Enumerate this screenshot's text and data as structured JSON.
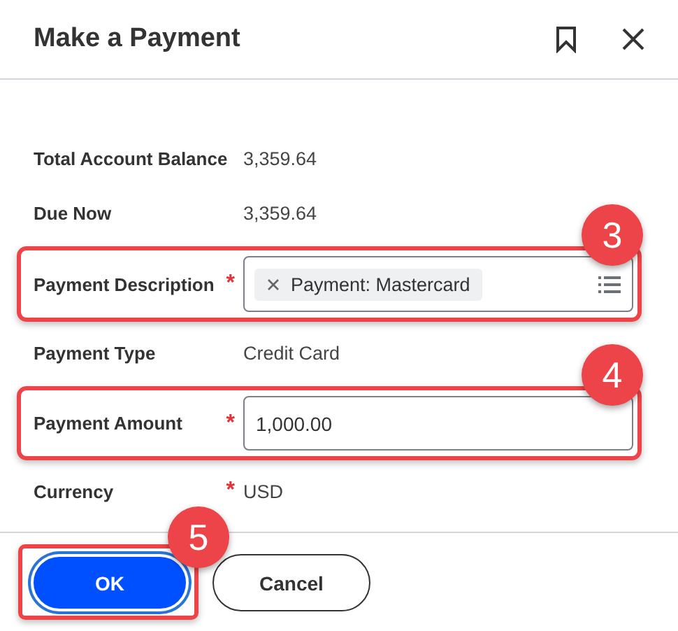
{
  "dialog": {
    "title": "Make a Payment"
  },
  "fields": [
    {
      "kind": "static",
      "label": "Total Account Balance",
      "value": "3,359.64"
    },
    {
      "kind": "static",
      "label": "Due Now",
      "value": "3,359.64"
    },
    {
      "kind": "tags",
      "label": "Payment Description",
      "required_marker": "*",
      "tags": [
        "Payment: Mastercard"
      ],
      "callout": "3"
    },
    {
      "kind": "static",
      "label": "Payment Type",
      "value": "Credit Card"
    },
    {
      "kind": "input",
      "label": "Payment Amount",
      "required_marker": "*",
      "value": "1,000.00",
      "callout": "4"
    },
    {
      "kind": "static",
      "label": "Currency",
      "required_marker": "*",
      "value": "USD"
    }
  ],
  "buttons": [
    {
      "kind": "primary",
      "label": "OK",
      "callout": "5"
    },
    {
      "kind": "secondary",
      "label": "Cancel"
    }
  ]
}
